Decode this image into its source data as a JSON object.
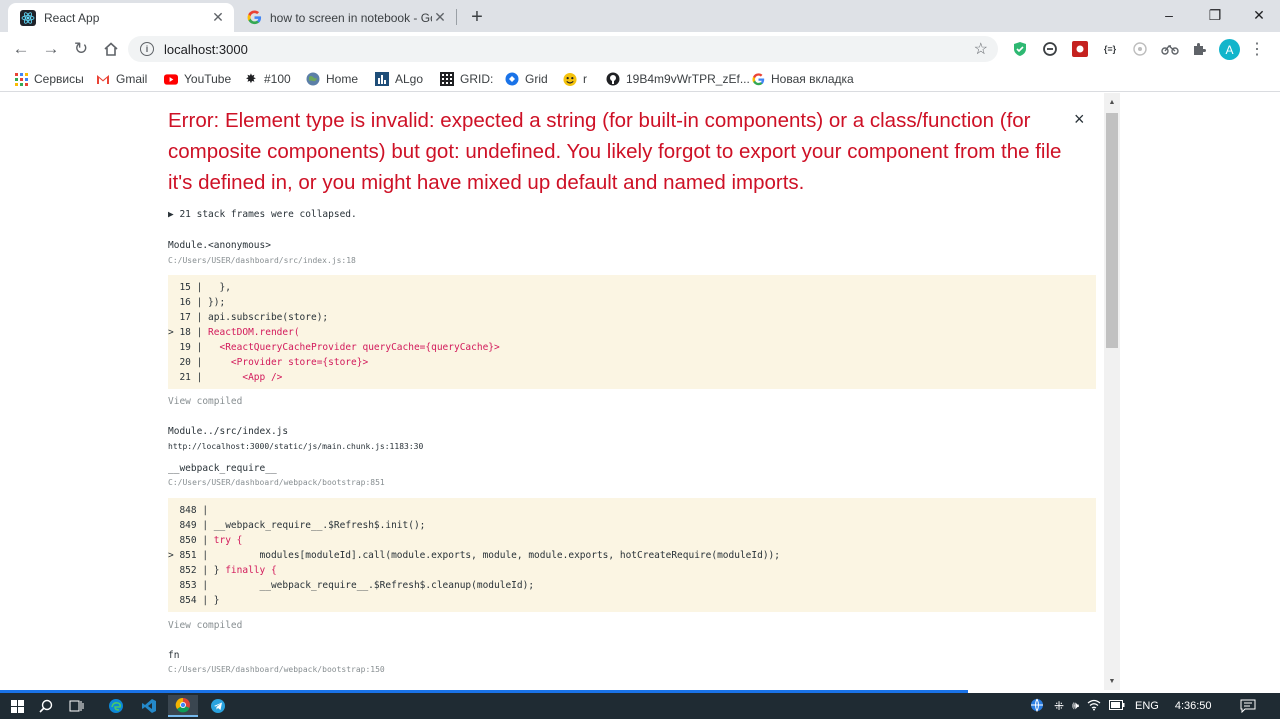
{
  "tabs": [
    {
      "title": "React App",
      "icon": "react-icon"
    },
    {
      "title": "how to screen in notebook - Goo",
      "icon": "google-icon"
    }
  ],
  "window_controls": {
    "minimize": "–",
    "maximize": "❐",
    "close": "✕"
  },
  "toolbar": {
    "url": "localhost:3000"
  },
  "profile_initial": "A",
  "bookmarks": [
    {
      "label": "Сервисы",
      "icon": "apps-grid-icon"
    },
    {
      "label": "Gmail",
      "icon": "gmail-icon"
    },
    {
      "label": "YouTube",
      "icon": "youtube-icon"
    },
    {
      "label": "#100",
      "icon": "codeforces-icon"
    },
    {
      "label": "Home",
      "icon": "globe-icon"
    },
    {
      "label": "ALgo",
      "icon": "algo-icon"
    },
    {
      "label": "GRID:",
      "icon": "grid-icon"
    },
    {
      "label": "Grid",
      "icon": "grid-circle-icon"
    },
    {
      "label": "r",
      "icon": "emoji-icon"
    },
    {
      "label": "19B4m9vWrTPR_zEf...",
      "icon": "github-icon"
    },
    {
      "label": "Новая вкладка",
      "icon": "google-icon"
    }
  ],
  "error": {
    "title": "Error: Element type is invalid: expected a string (for built-in components) or a class/function (for composite components) but got: undefined. You likely forgot to export your component from the file it's defined in, or you might have mixed up default and named imports.",
    "close": "×",
    "collapsed": "▶ 21 stack frames were collapsed."
  },
  "frames": [
    {
      "fn": "Module.<anonymous>",
      "file": "C:/Users/USER/dashboard/src/index.js:18",
      "code": [
        {
          "prefix": "  15 |   ",
          "text": "},",
          "hl": false
        },
        {
          "prefix": "  16 | ",
          "text": "});",
          "hl": false
        },
        {
          "prefix": "  17 | ",
          "text": "api.subscribe(store);",
          "hl": false
        },
        {
          "prefix": "> 18 | ",
          "text": "ReactDOM.render(",
          "hl": true
        },
        {
          "prefix": "  19 |   ",
          "text": "<ReactQueryCacheProvider queryCache={queryCache}>",
          "hl": true
        },
        {
          "prefix": "  20 |     ",
          "text": "<Provider store={store}>",
          "hl": true
        },
        {
          "prefix": "  21 |       ",
          "text": "<App />",
          "hl": true
        }
      ],
      "view": "View compiled"
    },
    {
      "fn": "Module../src/index.js",
      "file": "http://localhost:3000/static/js/main.chunk.js:1183:30"
    },
    {
      "fn": "__webpack_require__",
      "file": "C:/Users/USER/dashboard/webpack/bootstrap:851",
      "code": [
        {
          "prefix": "  848 | ",
          "text": "",
          "hl": false
        },
        {
          "prefix": "  849 | ",
          "text": "__webpack_require__.$Refresh$.init();",
          "hl": false
        },
        {
          "prefix": "  850 | ",
          "text": "try {",
          "hl": true
        },
        {
          "prefix": "> 851 |         ",
          "text": "modules[moduleId].call(module.exports, module, module.exports, hotCreateRequire(moduleId));",
          "hl": false
        },
        {
          "prefix": "  852 | } ",
          "text": "finally {",
          "hl": true
        },
        {
          "prefix": "  853 |         ",
          "text": "__webpack_require__.$Refresh$.cleanup(moduleId);",
          "hl": false
        },
        {
          "prefix": "  854 | ",
          "text": "}",
          "hl": false
        }
      ],
      "view": "View compiled"
    },
    {
      "fn": "fn",
      "file": "C:/Users/USER/dashboard/webpack/bootstrap:150"
    }
  ],
  "taskbar": {
    "language": "ENG",
    "time": "4:36:50"
  },
  "colors": {
    "error_red": "#ce1126",
    "code_bg": "#fbf5e3",
    "taskbar": "#1f2b33"
  }
}
